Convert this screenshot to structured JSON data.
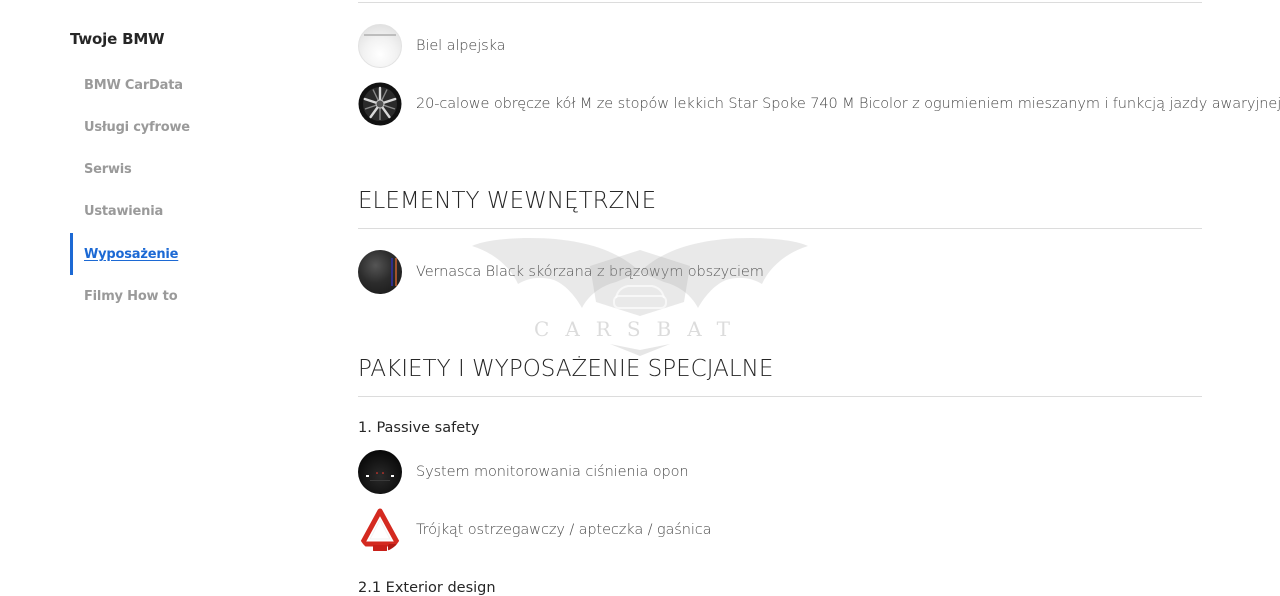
{
  "sidebar": {
    "title": "Twoje BMW",
    "items": [
      {
        "label": "BMW CarData",
        "active": false
      },
      {
        "label": "Usługi cyfrowe",
        "active": false
      },
      {
        "label": "Serwis",
        "active": false
      },
      {
        "label": "Ustawienia",
        "active": false
      },
      {
        "label": "Wyposażenie",
        "active": true
      },
      {
        "label": "Filmy How to",
        "active": false
      }
    ]
  },
  "exterior_items": [
    {
      "label": "Biel alpejska",
      "icon": "paint-swatch-icon"
    },
    {
      "label": "20-calowe obręcze kół M ze stopów lekkich Star Spoke 740 M Bicolor z ogumieniem mieszanym i funkcją jazdy awaryjnej",
      "icon": "wheel-rim-icon"
    }
  ],
  "interior": {
    "title": "ELEMENTY WEWNĘTRZNE",
    "items": [
      {
        "label": "Vernasca Black skórzana z brązowym obszyciem",
        "icon": "leather-swatch-icon"
      }
    ]
  },
  "packages": {
    "title": "PAKIETY I WYPOSAŻENIE SPECJALNE",
    "groups": [
      {
        "title": "1. Passive safety",
        "items": [
          {
            "label": "System monitorowania ciśnienia opon",
            "icon": "tire-pressure-icon"
          },
          {
            "label": "Trójkąt ostrzegawczy / apteczka / gaśnica",
            "icon": "warning-triangle-icon"
          }
        ]
      },
      {
        "title": "2.1 Exterior design",
        "items": []
      }
    ]
  },
  "watermark": {
    "text": "CARSBAT"
  },
  "colors": {
    "accent": "#1c69d4",
    "muted_nav": "#9a9a9a",
    "divider": "#dcdcdc"
  }
}
